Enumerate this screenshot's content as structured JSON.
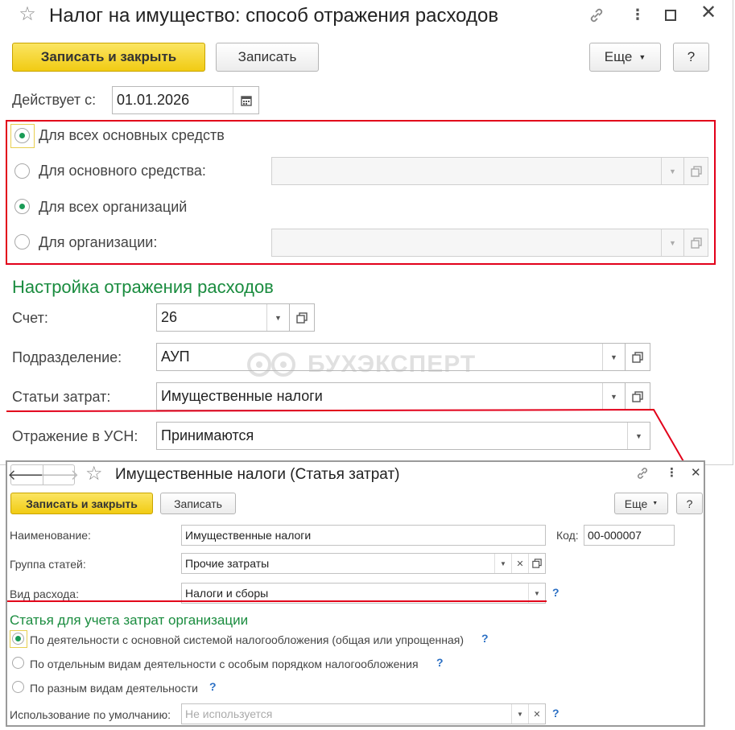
{
  "main": {
    "title": "Налог на имущество: способ отражения расходов",
    "toolbar": {
      "save_close": "Записать и закрыть",
      "save": "Записать",
      "more": "Еще",
      "help": "?"
    },
    "valid_from_label": "Действует с:",
    "valid_from_value": "01.01.2026",
    "options": {
      "all_assets": "Для всех основных средств",
      "one_asset": "Для основного средства:",
      "all_orgs": "Для всех организаций",
      "one_org": "Для организации:"
    },
    "section_title": "Настройка отражения расходов",
    "fields": {
      "account_label": "Счет:",
      "account_value": "26",
      "division_label": "Подразделение:",
      "division_value": "АУП",
      "cost_items_label": "Статьи затрат:",
      "cost_items_value": "Имущественные налоги",
      "usn_label": "Отражение в УСН:",
      "usn_value": "Принимаются"
    },
    "watermark": "БУХЭКСПЕРТ"
  },
  "sub": {
    "title": "Имущественные налоги (Статья затрат)",
    "toolbar": {
      "save_close": "Записать и закрыть",
      "save": "Записать",
      "more": "Еще",
      "help": "?"
    },
    "name_label": "Наименование:",
    "name_value": "Имущественные налоги",
    "code_label": "Код:",
    "code_value": "00-000007",
    "group_label": "Группа статей:",
    "group_value": "Прочие затраты",
    "expense_kind_label": "Вид расхода:",
    "expense_kind_value": "Налоги и сборы",
    "section_title": "Статья для учета затрат организации",
    "radio_options": [
      "По деятельности с основной системой налогообложения (общая или упрощенная)",
      "По отдельным видам деятельности с особым порядком налогообложения",
      "По разным видам деятельности"
    ],
    "default_usage_label": "Использование по умолчанию:",
    "default_usage_placeholder": "Не используется",
    "help_mark": "?"
  },
  "colors": {
    "accent_yellow": "#f5d22c",
    "section_green": "#1a8c3f",
    "highlight_red": "#e2001a",
    "help_blue": "#2a6fc4"
  }
}
